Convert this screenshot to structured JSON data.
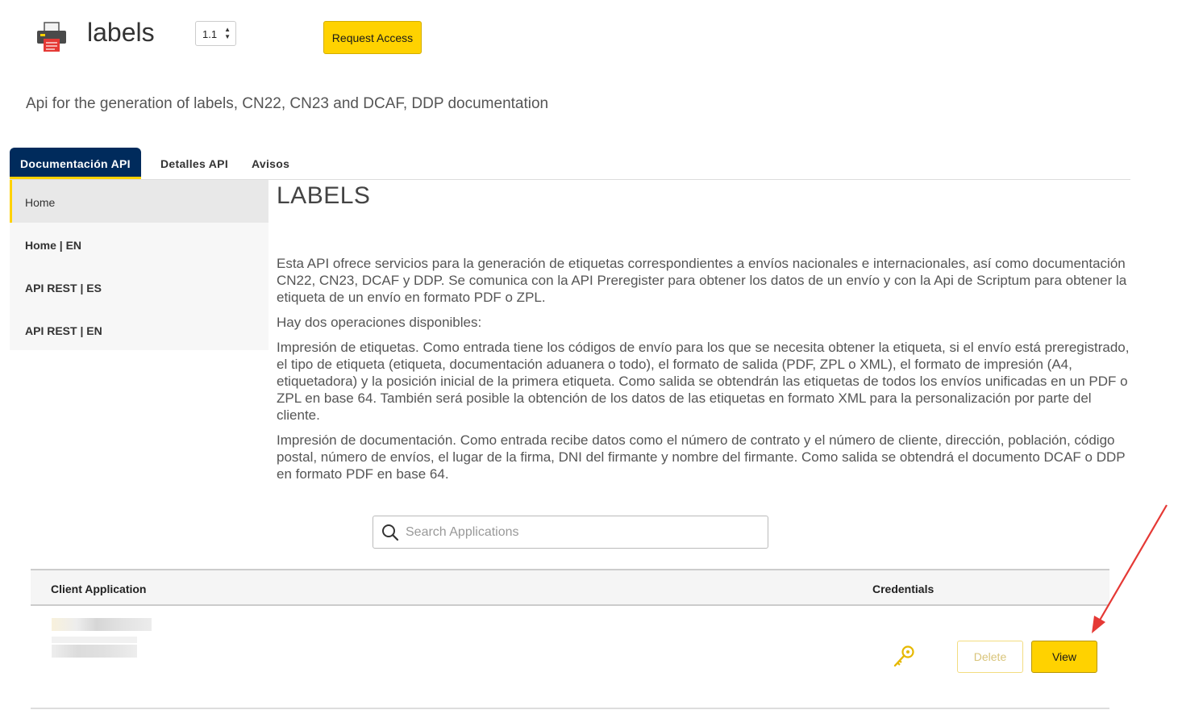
{
  "header": {
    "title": "labels",
    "version": "1.1",
    "request_access_label": "Request Access"
  },
  "subtitle": "Api for the generation of labels, CN22, CN23 and DCAF, DDP documentation",
  "tabs": [
    {
      "label": "Documentación API",
      "active": true
    },
    {
      "label": "Detalles API",
      "active": false
    },
    {
      "label": "Avisos",
      "active": false
    }
  ],
  "sidebar": {
    "items": [
      {
        "label": "Home"
      },
      {
        "label": "Home | EN"
      },
      {
        "label": "API REST | ES"
      },
      {
        "label": "API REST | EN"
      }
    ]
  },
  "content": {
    "heading": "LABELS",
    "paragraphs": [
      "Esta API ofrece servicios para la generación de etiquetas correspondientes a envíos nacionales e internacionales, así como documentación CN22, CN23, DCAF y DDP. Se comunica con la API Preregister para obtener los datos de un envío y con la Api de Scriptum para obtener la etiqueta de un envío en formato PDF o ZPL.",
      "Hay dos operaciones disponibles:",
      "Impresión de etiquetas. Como entrada tiene los códigos de envío para los que se necesita obtener la etiqueta, si el envío está preregistrado, el tipo de etiqueta (etiqueta, documentación aduanera o todo), el formato de salida (PDF, ZPL o XML), el formato de impresión (A4, etiquetadora) y la posición inicial de la primera etiqueta. Como salida se obtendrán las etiquetas de todos los envíos unificadas en un PDF o ZPL en base 64. También será posible la obtención de los datos de las etiquetas en formato XML para la personalización por parte del cliente.",
      "Impresión de documentación. Como entrada recibe datos como el número de contrato y el número de cliente, dirección, población, código postal, número de envíos, el lugar de la firma, DNI del firmante y nombre del firmante. Como salida se obtendrá el documento DCAF o DDP en formato PDF en base 64."
    ]
  },
  "search": {
    "placeholder": "Search Applications",
    "value": ""
  },
  "table": {
    "columns": [
      "Client Application",
      "Credentials"
    ],
    "row": {
      "delete_label": "Delete",
      "view_label": "View"
    }
  },
  "colors": {
    "brand_navy": "#002b5c",
    "accent_yellow": "#ffd200",
    "annotation_red": "#e53935"
  },
  "icons": [
    "printer-logo-icon",
    "search-icon",
    "key-icon",
    "arrow-annotation"
  ]
}
